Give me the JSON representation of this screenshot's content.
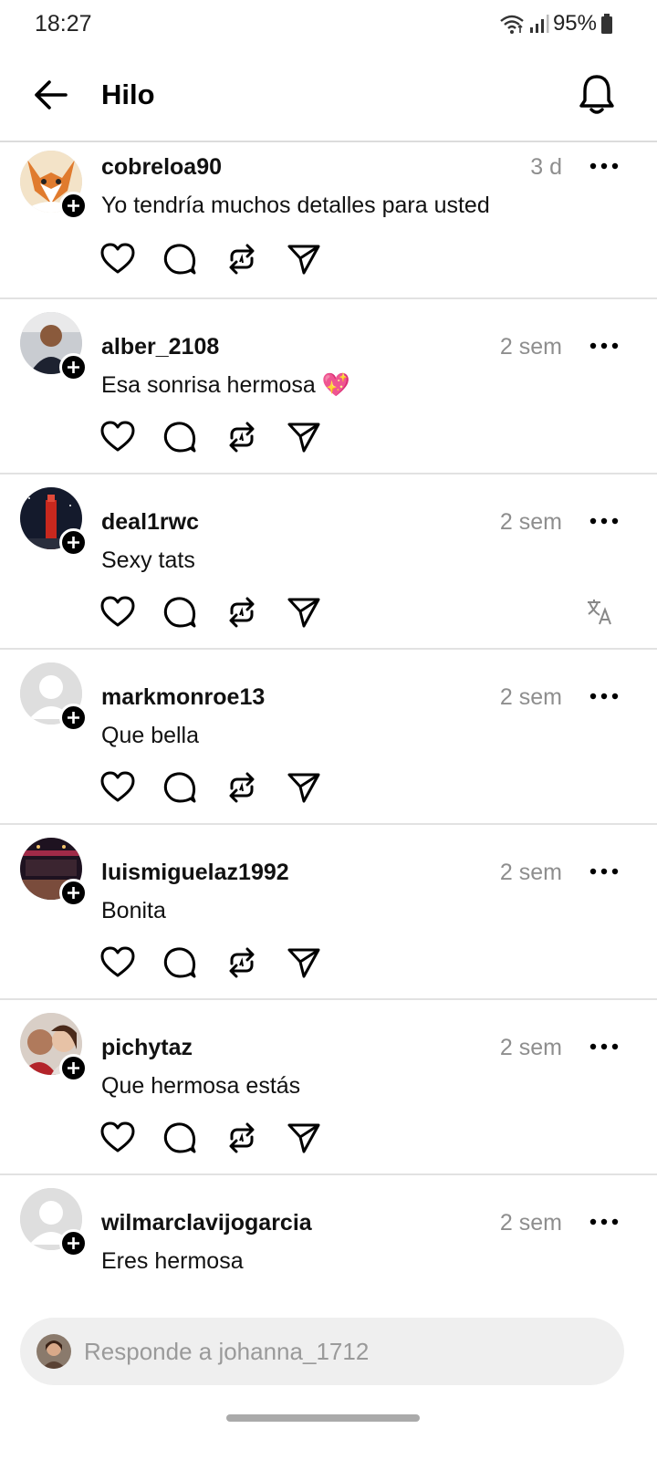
{
  "status_bar": {
    "time": "18:27",
    "battery": "95%",
    "icons": [
      "wifi-icon",
      "signal-icon",
      "battery-icon"
    ]
  },
  "header": {
    "title": "Hilo",
    "back_icon": "arrow-left-icon",
    "notification_icon": "bell-icon"
  },
  "comments": [
    {
      "username": "cobreloa90",
      "time": "3 d",
      "text": "Yo tendría muchos detalles para usted",
      "avatar": "fox"
    },
    {
      "username": "alber_2108",
      "time": "2 sem",
      "text": "Esa sonrisa hermosa 💖",
      "avatar": "man"
    },
    {
      "username": "deal1rwc",
      "time": "2 sem",
      "text": "Sexy tats",
      "avatar": "tower",
      "translate": true
    },
    {
      "username": "markmonroe13",
      "time": "2 sem",
      "text": "Que bella",
      "avatar": "default"
    },
    {
      "username": "luismiguelaz1992",
      "time": "2 sem",
      "text": "Bonita",
      "avatar": "room"
    },
    {
      "username": "pichytaz",
      "time": "2 sem",
      "text": "Que hermosa estás",
      "avatar": "couple"
    },
    {
      "username": "wilmarclavijogarcia",
      "time": "2 sem",
      "text": "Eres hermosa",
      "avatar": "default"
    }
  ],
  "action_icons": [
    "heart-icon",
    "comment-icon",
    "repost-icon",
    "share-icon"
  ],
  "reply": {
    "placeholder": "Responde a johanna_1712"
  },
  "colors": {
    "background": "#ffffff",
    "secondary_text": "#8e8e8e",
    "divider": "#e2e2e2",
    "input_bg": "#efefef"
  }
}
